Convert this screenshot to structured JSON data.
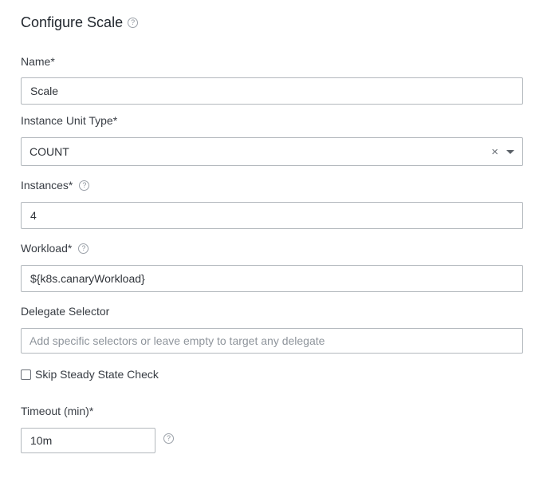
{
  "page": {
    "title": "Configure Scale",
    "help_icon": "?"
  },
  "form": {
    "name": {
      "label": "Name*",
      "value": "Scale"
    },
    "instance_unit_type": {
      "label": "Instance Unit Type*",
      "value": "COUNT",
      "clear_icon": "×"
    },
    "instances": {
      "label": "Instances*",
      "value": "4"
    },
    "workload": {
      "label": "Workload*",
      "value": "${k8s.canaryWorkload}"
    },
    "delegate_selector": {
      "label": "Delegate Selector",
      "placeholder": "Add specific selectors or leave empty to target any delegate"
    },
    "skip_steady_state": {
      "label": "Skip Steady State Check",
      "checked": false
    },
    "timeout": {
      "label": "Timeout (min)*",
      "value": "10m"
    }
  }
}
